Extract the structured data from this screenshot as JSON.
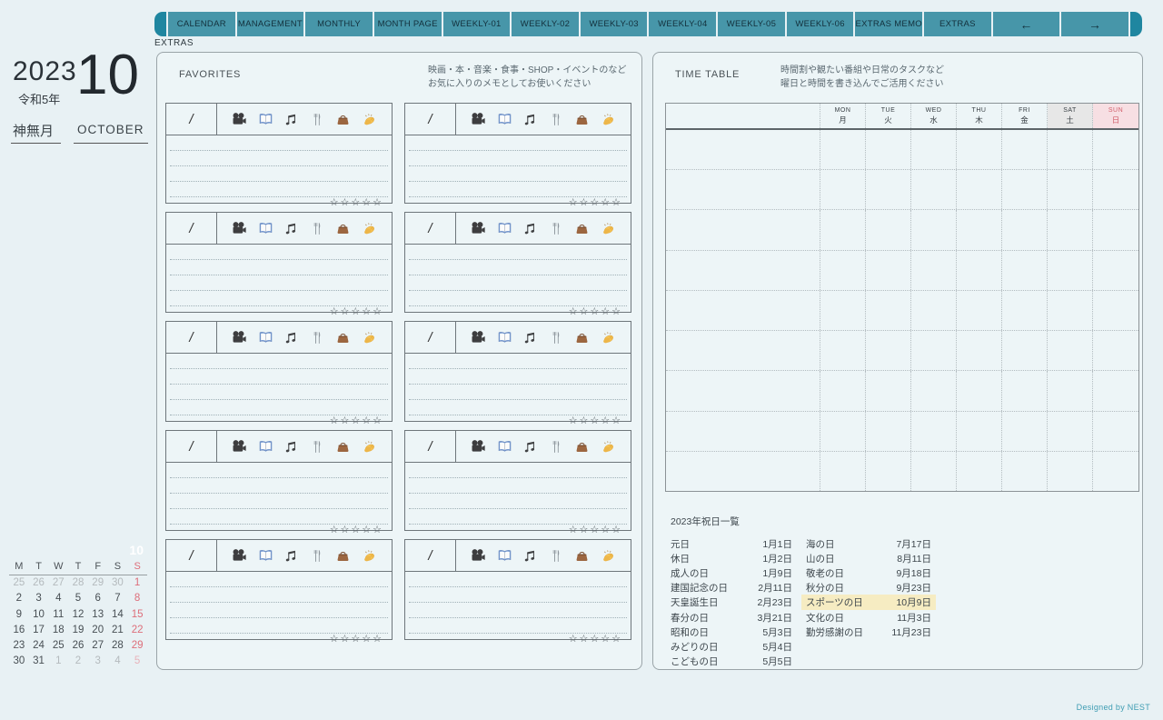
{
  "nav": {
    "tabs": [
      "CALENDAR",
      "MANAGEMENT",
      "MONTHLY",
      "MONTH PAGE",
      "WEEKLY-01",
      "WEEKLY-02",
      "WEEKLY-03",
      "WEEKLY-04",
      "WEEKLY-05",
      "WEEKLY-06",
      "EXTRAS MEMO",
      "EXTRAS"
    ],
    "arrow_left": "←",
    "arrow_right": "→",
    "current_page_label": "EXTRAS"
  },
  "sidebar": {
    "year": "2023",
    "era": "令和5年",
    "month_number": "10",
    "month_name_jp": "神無月",
    "month_name_en": "OCTOBER"
  },
  "mini_calendar": {
    "month_label": "10",
    "day_headers": [
      "M",
      "T",
      "W",
      "T",
      "F",
      "S",
      "S"
    ],
    "weeks": [
      [
        {
          "d": "25",
          "c": "muted"
        },
        {
          "d": "26",
          "c": "muted"
        },
        {
          "d": "27",
          "c": "muted"
        },
        {
          "d": "28",
          "c": "muted"
        },
        {
          "d": "29",
          "c": "muted"
        },
        {
          "d": "30",
          "c": "muted"
        },
        {
          "d": "1",
          "c": "sun"
        }
      ],
      [
        {
          "d": "2"
        },
        {
          "d": "3"
        },
        {
          "d": "4"
        },
        {
          "d": "5"
        },
        {
          "d": "6"
        },
        {
          "d": "7"
        },
        {
          "d": "8",
          "c": "sun"
        }
      ],
      [
        {
          "d": "9"
        },
        {
          "d": "10"
        },
        {
          "d": "11"
        },
        {
          "d": "12"
        },
        {
          "d": "13"
        },
        {
          "d": "14"
        },
        {
          "d": "15",
          "c": "sun"
        }
      ],
      [
        {
          "d": "16"
        },
        {
          "d": "17"
        },
        {
          "d": "18"
        },
        {
          "d": "19"
        },
        {
          "d": "20"
        },
        {
          "d": "21"
        },
        {
          "d": "22",
          "c": "sun"
        }
      ],
      [
        {
          "d": "23"
        },
        {
          "d": "24"
        },
        {
          "d": "25"
        },
        {
          "d": "26"
        },
        {
          "d": "27"
        },
        {
          "d": "28"
        },
        {
          "d": "29",
          "c": "sun"
        }
      ],
      [
        {
          "d": "30"
        },
        {
          "d": "31"
        },
        {
          "d": "1",
          "c": "muted"
        },
        {
          "d": "2",
          "c": "muted"
        },
        {
          "d": "3",
          "c": "muted"
        },
        {
          "d": "4",
          "c": "muted"
        },
        {
          "d": "5",
          "c": "sun-muted"
        }
      ]
    ]
  },
  "favorites": {
    "title": "FAVORITES",
    "note_line1": "映画・本・音楽・食事・SHOP・イベントのなど",
    "note_line2": "お気に入りのメモとしてお使いください",
    "date_placeholder": "/",
    "icons": [
      "movie-camera",
      "open-book",
      "musical-notes",
      "fork-knife",
      "handbag",
      "clapping-hands"
    ],
    "stars": "☆☆☆☆☆",
    "block_count": 10,
    "lines_per_block": 4
  },
  "timetable": {
    "title": "TIME TABLE",
    "note_line1": "時間割や観たい番組や日常のタスクなど",
    "note_line2": "曜日と時間を書き込んでご活用ください",
    "columns": [
      {
        "en": "MON",
        "jp": "月"
      },
      {
        "en": "TUE",
        "jp": "火"
      },
      {
        "en": "WED",
        "jp": "水"
      },
      {
        "en": "THU",
        "jp": "木"
      },
      {
        "en": "FRI",
        "jp": "金"
      },
      {
        "en": "SAT",
        "jp": "土",
        "style": "sat"
      },
      {
        "en": "SUN",
        "jp": "日",
        "style": "sun"
      }
    ],
    "body_row_count": 9
  },
  "holidays": {
    "title": "2023年祝日一覧",
    "column1": [
      {
        "name": "元日",
        "date": "1月1日"
      },
      {
        "name": "休日",
        "date": "1月2日"
      },
      {
        "name": "成人の日",
        "date": "1月9日"
      },
      {
        "name": "建国記念の日",
        "date": "2月11日"
      },
      {
        "name": "天皇誕生日",
        "date": "2月23日"
      },
      {
        "name": "春分の日",
        "date": "3月21日"
      },
      {
        "name": "昭和の日",
        "date": "5月3日"
      },
      {
        "name": "みどりの日",
        "date": "5月4日"
      },
      {
        "name": "こどもの日",
        "date": "5月5日"
      }
    ],
    "column2": [
      {
        "name": "海の日",
        "date": "7月17日"
      },
      {
        "name": "山の日",
        "date": "8月11日"
      },
      {
        "name": "敬老の日",
        "date": "9月18日"
      },
      {
        "name": "秋分の日",
        "date": "9月23日"
      },
      {
        "name": "スポーツの日",
        "date": "10月9日",
        "highlight": true
      },
      {
        "name": "文化の日",
        "date": "11月3日"
      },
      {
        "name": "勤労感謝の日",
        "date": "11月23日"
      }
    ]
  },
  "footer": {
    "designed_by": "Designed by NEST"
  },
  "colors": {
    "tab": "#4796a9",
    "tab_cap": "#1f86a0",
    "page_bg": "#e8f1f4",
    "sunday_red": "#dd6e7a",
    "sat_header_bg": "#e7e7e7",
    "sun_header_bg": "#f7dfe3",
    "holiday_highlight": "#f6ecc2",
    "accent": "#3f9db3"
  }
}
